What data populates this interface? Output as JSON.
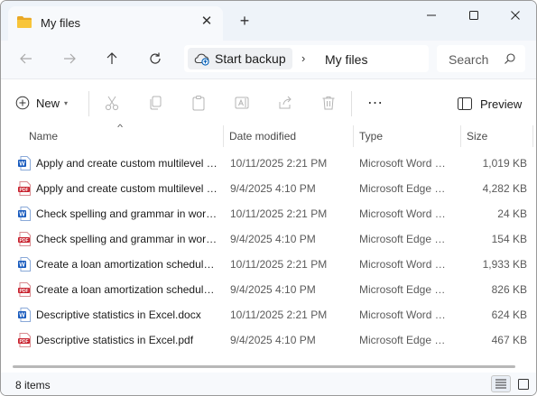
{
  "window": {
    "tab_title": "My files",
    "tab_close_glyph": "✕",
    "new_tab_glyph": "+"
  },
  "toolbar": {
    "backup_label": "Start backup",
    "breadcrumb_separator": "›",
    "breadcrumb_current": "My files",
    "search_placeholder": "Search"
  },
  "commands": {
    "new_label": "New",
    "new_caret": "▾",
    "more_glyph": "…",
    "preview_label": "Preview",
    "icons": [
      "cut-icon",
      "copy-icon",
      "paste-icon",
      "rename-icon",
      "share-icon",
      "delete-icon"
    ]
  },
  "columns": {
    "name": "Name",
    "date": "Date modified",
    "type": "Type",
    "size": "Size",
    "sort_glyph": "^"
  },
  "files": [
    {
      "kind": "word",
      "name": "Apply and create custom multilevel list numbering in Word.docx",
      "date": "10/11/2025 2:21 PM",
      "type": "Microsoft Word Document",
      "size": "1,019 KB"
    },
    {
      "kind": "pdf",
      "name": "Apply and create custom multilevel list numbering in Word.pdf",
      "date": "9/4/2025 4:10 PM",
      "type": "Microsoft Edge PDF Document",
      "size": "4,282 KB"
    },
    {
      "kind": "word",
      "name": "Check spelling and grammar in word.docx",
      "date": "10/11/2025 2:21 PM",
      "type": "Microsoft Word Document",
      "size": "24 KB"
    },
    {
      "kind": "pdf",
      "name": "Check spelling and grammar in word.pdf",
      "date": "9/4/2025 4:10 PM",
      "type": "Microsoft Edge PDF Document",
      "size": "154 KB"
    },
    {
      "kind": "word",
      "name": "Create a loan amortization schedule in Excel.docx",
      "date": "10/11/2025 2:21 PM",
      "type": "Microsoft Word Document",
      "size": "1,933 KB"
    },
    {
      "kind": "pdf",
      "name": "Create a loan amortization schedule in Excel.pdf",
      "date": "9/4/2025 4:10 PM",
      "type": "Microsoft Edge PDF Document",
      "size": "826 KB"
    },
    {
      "kind": "word",
      "name": "Descriptive statistics in Excel.docx",
      "date": "10/11/2025 2:21 PM",
      "type": "Microsoft Word Document",
      "size": "624 KB"
    },
    {
      "kind": "pdf",
      "name": "Descriptive statistics in Excel.pdf",
      "date": "9/4/2025 4:10 PM",
      "type": "Microsoft Edge PDF Document",
      "size": "467 KB"
    }
  ],
  "status": {
    "count": "8 items"
  },
  "colors": {
    "word_blue": "#185abd",
    "pdf_red": "#c8202d",
    "folder_yellow": "#f8c53a",
    "accent": "#005fb8"
  }
}
